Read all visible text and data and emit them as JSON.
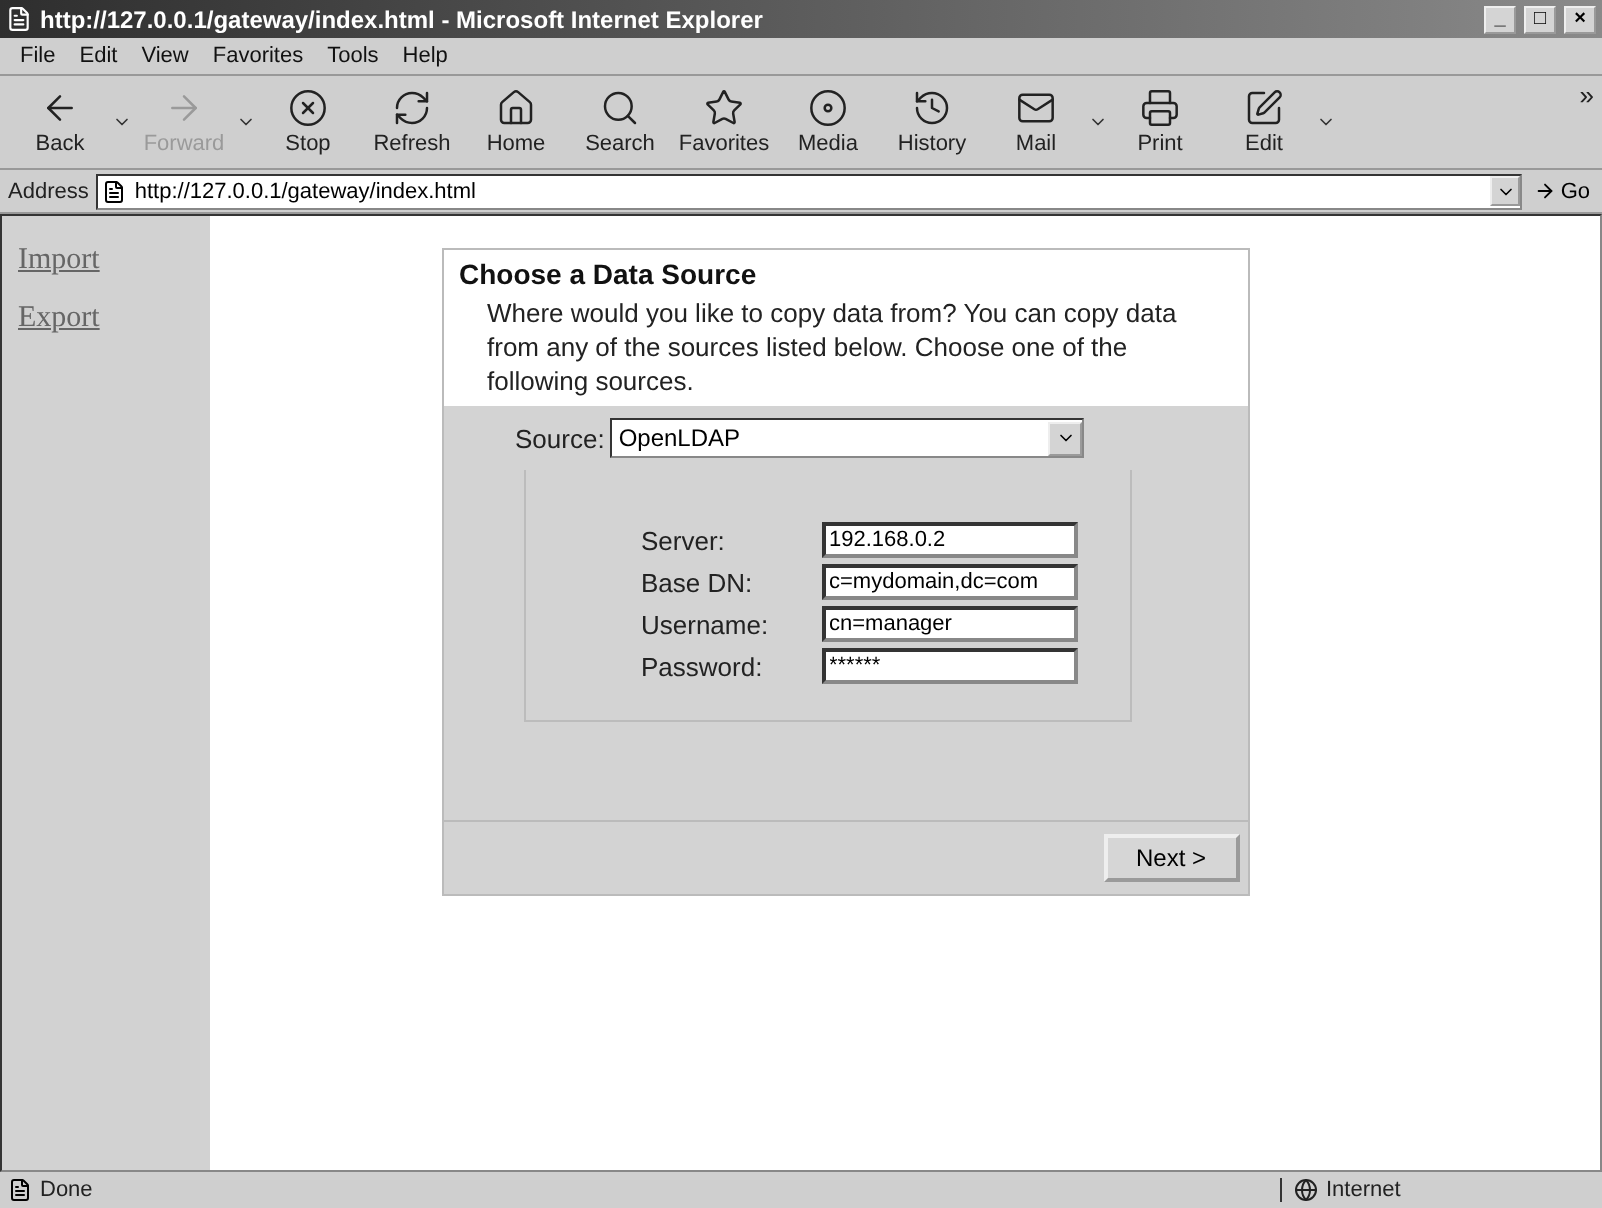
{
  "window": {
    "title": "http://127.0.0.1/gateway/index.html - Microsoft Internet Explorer",
    "controls": [
      "_",
      "□",
      "×"
    ]
  },
  "menu": [
    "File",
    "Edit",
    "View",
    "Favorites",
    "Tools",
    "Help"
  ],
  "toolbar": [
    {
      "kind": "back",
      "label": "Back",
      "disabled": false,
      "dropdown": true
    },
    {
      "kind": "forward",
      "label": "Forward",
      "disabled": true,
      "dropdown": true
    },
    {
      "kind": "stop",
      "label": "Stop",
      "disabled": false,
      "dropdown": false
    },
    {
      "kind": "refresh",
      "label": "Refresh",
      "disabled": false,
      "dropdown": false
    },
    {
      "kind": "home",
      "label": "Home",
      "disabled": false,
      "dropdown": false
    },
    {
      "kind": "search",
      "label": "Search",
      "disabled": false,
      "dropdown": false
    },
    {
      "kind": "favorites",
      "label": "Favorites",
      "disabled": false,
      "dropdown": false
    },
    {
      "kind": "media",
      "label": "Media",
      "disabled": false,
      "dropdown": false
    },
    {
      "kind": "history",
      "label": "History",
      "disabled": false,
      "dropdown": false
    },
    {
      "kind": "mail",
      "label": "Mail",
      "disabled": false,
      "dropdown": true
    },
    {
      "kind": "print",
      "label": "Print",
      "disabled": false,
      "dropdown": false
    },
    {
      "kind": "edit",
      "label": "Edit",
      "disabled": false,
      "dropdown": true
    }
  ],
  "toolbar_more": "»",
  "address": {
    "label": "Address",
    "value": "http://127.0.0.1/gateway/index.html",
    "go": "Go"
  },
  "sidebar": {
    "links": [
      "Import",
      "Export"
    ]
  },
  "form": {
    "title": "Choose a Data Source",
    "description": "Where would you like to copy data from? You can copy data from any of the sources listed below. Choose one of the following sources.",
    "source": {
      "label": "Source:",
      "value": "OpenLDAP"
    },
    "fields": [
      {
        "label": "Server:",
        "value": "192.168.0.2"
      },
      {
        "label": "Base DN:",
        "value": "c=mydomain,dc=com"
      },
      {
        "label": "Username:",
        "value": "cn=manager"
      },
      {
        "label": "Password:",
        "value": "******"
      }
    ],
    "next": "Next >"
  },
  "status_bar": {
    "text": "Done",
    "zone": "Internet"
  }
}
